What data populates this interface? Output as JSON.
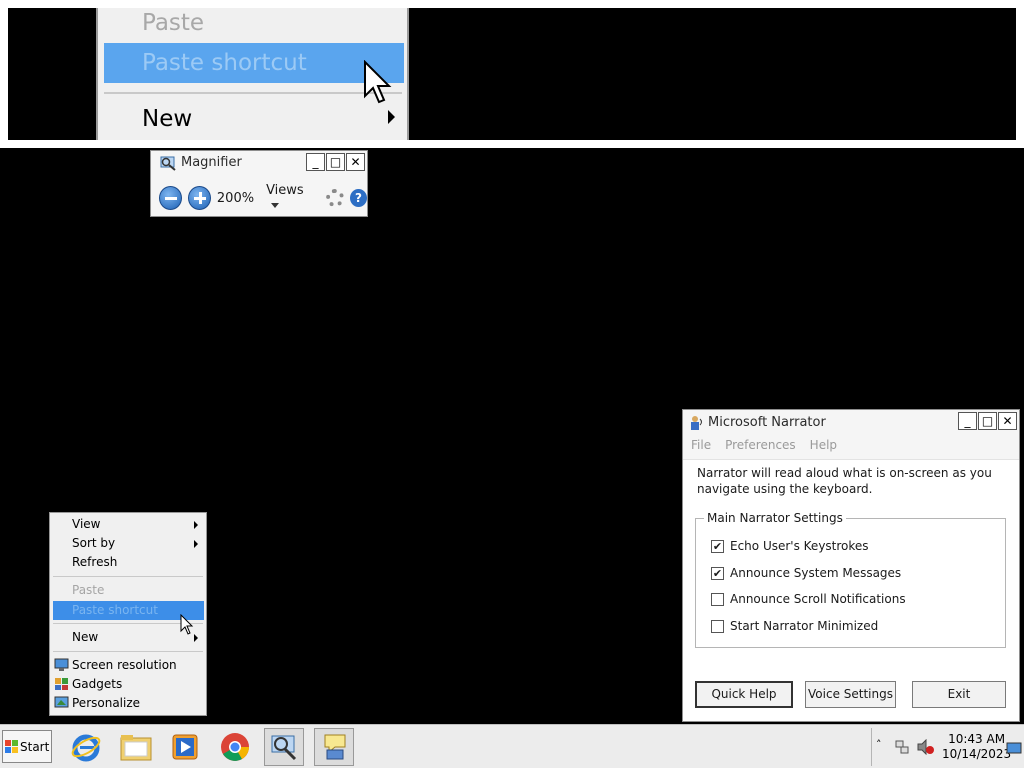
{
  "zoomed_menu": {
    "items": [
      {
        "label": "Paste",
        "state": "disabled"
      },
      {
        "label": "Paste shortcut",
        "state": "highlighted-disabled"
      },
      {
        "label": "New",
        "state": "normal",
        "submenu": true
      }
    ]
  },
  "magnifier": {
    "title": "Magnifier",
    "zoom_level": "200%",
    "views_label": "Views",
    "buttons": {
      "minimize": "_",
      "maximize": "□",
      "close": "✕"
    }
  },
  "context_menu": {
    "items": [
      {
        "label": "View",
        "submenu": true,
        "state": "normal"
      },
      {
        "label": "Sort by",
        "submenu": true,
        "state": "normal"
      },
      {
        "label": "Refresh",
        "submenu": false,
        "state": "normal"
      },
      {
        "label": "Paste",
        "submenu": false,
        "state": "disabled"
      },
      {
        "label": "Paste shortcut",
        "submenu": false,
        "state": "highlighted-disabled"
      },
      {
        "label": "New",
        "submenu": true,
        "state": "normal"
      },
      {
        "label": "Screen resolution",
        "icon": "monitor-icon"
      },
      {
        "label": "Gadgets",
        "icon": "gadgets-icon"
      },
      {
        "label": "Personalize",
        "icon": "personalize-icon"
      }
    ]
  },
  "narrator": {
    "title": "Microsoft Narrator",
    "menu": [
      "File",
      "Preferences",
      "Help"
    ],
    "description": "Narrator will read aloud what is on-screen as you navigate using the keyboard.",
    "group_label": "Main Narrator Settings",
    "options": [
      {
        "label": "Echo User's Keystrokes",
        "checked": true
      },
      {
        "label": "Announce System Messages",
        "checked": true
      },
      {
        "label": "Announce Scroll Notifications",
        "checked": false
      },
      {
        "label": "Start Narrator Minimized",
        "checked": false
      }
    ],
    "buttons": {
      "quick_help": "Quick Help",
      "voice_settings": "Voice Settings",
      "exit": "Exit"
    }
  },
  "taskbar": {
    "start_label": "Start",
    "pinned": [
      "internet-explorer-icon",
      "file-explorer-icon",
      "media-player-icon",
      "chrome-icon",
      "magnifier-app-icon",
      "narrator-app-icon"
    ],
    "time": "10:43 AM",
    "date": "10/14/2023"
  },
  "colors": {
    "highlight": "#3d8ee8",
    "taskbar": "#ececec"
  }
}
